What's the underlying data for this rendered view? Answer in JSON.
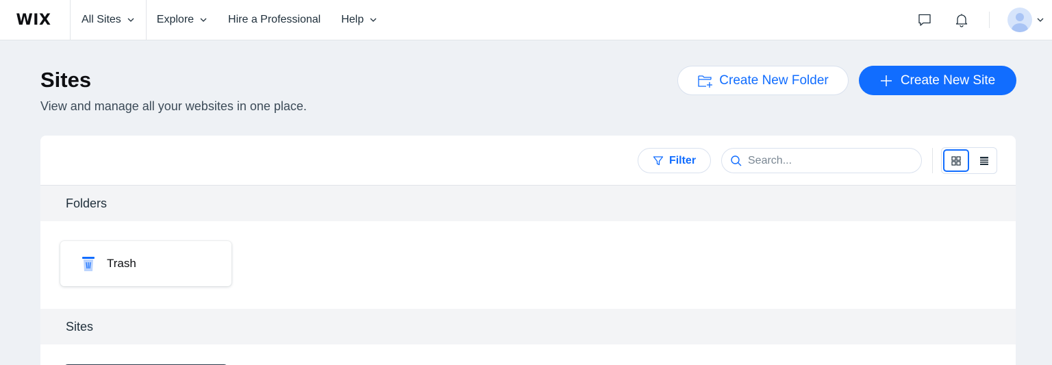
{
  "brand": {
    "logo": "WIX"
  },
  "nav": {
    "all_sites": "All Sites",
    "explore": "Explore",
    "hire": "Hire a Professional",
    "help": "Help"
  },
  "header_icons": [
    "chat-icon",
    "bell-icon",
    "avatar",
    "chevron-down-icon"
  ],
  "page": {
    "title": "Sites",
    "subtitle": "View and manage all your websites in one place."
  },
  "actions": {
    "create_folder": "Create New Folder",
    "create_site": "Create New Site"
  },
  "toolbar": {
    "filter_label": "Filter",
    "search_placeholder": "Search...",
    "view_mode": "grid"
  },
  "sections": {
    "folders_title": "Folders",
    "sites_title": "Sites"
  },
  "folders": [
    {
      "name": "Trash",
      "icon": "trash-icon"
    }
  ],
  "colors": {
    "accent": "#116dff",
    "background": "#eef1f5",
    "panel": "#ffffff"
  }
}
